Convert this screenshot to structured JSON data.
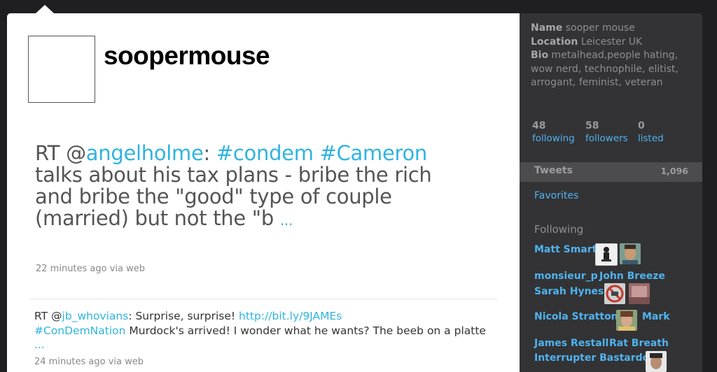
{
  "profile": {
    "screen_name": "soopermouse"
  },
  "latest_tweet": {
    "rt_prefix": "RT @",
    "mention": "angelholme",
    "colon": ": ",
    "hashtag1": "#condem",
    "hashtag2": "#Cameron",
    "text": " talks about his tax plans - bribe the rich and bribe the \"good\" type of couple (married) but not the \"b ",
    "ellipsis": "...",
    "meta": "22 minutes ago via web"
  },
  "tweets": [
    {
      "rt_prefix": "RT @",
      "mention": "jb_whovians",
      "text1": ": Surprise, surprise! ",
      "link": "http://bit.ly/9JAMEs",
      "hashtag": "#ConDemNation",
      "text2": " Murdock's arrived! I wonder what he wants? The beeb on a platte ",
      "ellipsis": "...",
      "meta": "24 minutes ago via web"
    }
  ],
  "sidebar": {
    "name_label": "Name",
    "name": "sooper mouse",
    "location_label": "Location",
    "location": "Leicester UK",
    "bio_label": "Bio",
    "bio": "metalhead,people hating, wow nerd, technophile, elitist, arrogant, feminist, veteran",
    "stats": [
      {
        "num": "48",
        "label": "following"
      },
      {
        "num": "58",
        "label": "followers"
      },
      {
        "num": "0",
        "label": "listed"
      }
    ],
    "tweets_label": "Tweets",
    "tweets_count": "1,096",
    "favorites": "Favorites",
    "following_title": "Following",
    "following": [
      {
        "name": "Matt Smart"
      },
      {
        "name": "monsieur_p"
      },
      {
        "name": "John Breeze"
      },
      {
        "name": "Sarah Hynes"
      },
      {
        "name": "Nicola Stratton"
      },
      {
        "name": "Mark"
      },
      {
        "name": "James Restall"
      },
      {
        "name": "Rat Breath"
      },
      {
        "name": "Interrupter Bastardo"
      }
    ]
  }
}
